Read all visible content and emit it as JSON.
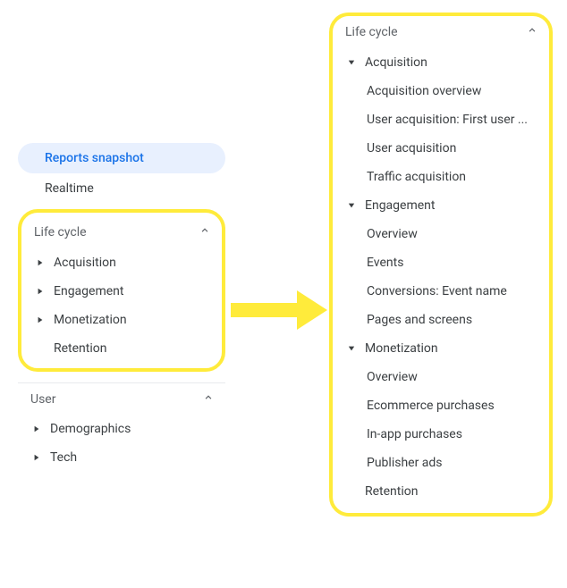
{
  "leftPanel": {
    "topItems": {
      "reportsSnapshot": "Reports snapshot",
      "realtime": "Realtime"
    },
    "lifeCycle": {
      "title": "Life cycle",
      "items": {
        "acquisition": "Acquisition",
        "engagement": "Engagement",
        "monetization": "Monetization",
        "retention": "Retention"
      }
    },
    "user": {
      "title": "User",
      "items": {
        "demographics": "Demographics",
        "tech": "Tech"
      }
    }
  },
  "rightPanel": {
    "lifeCycle": {
      "title": "Life cycle",
      "acquisition": {
        "label": "Acquisition",
        "children": {
          "overview": "Acquisition overview",
          "userFirst": "User acquisition: First user ...",
          "userAcq": "User acquisition",
          "trafficAcq": "Traffic acquisition"
        }
      },
      "engagement": {
        "label": "Engagement",
        "children": {
          "overview": "Overview",
          "events": "Events",
          "conversions": "Conversions: Event name",
          "pages": "Pages and screens"
        }
      },
      "monetization": {
        "label": "Monetization",
        "children": {
          "overview": "Overview",
          "ecommerce": "Ecommerce purchases",
          "inapp": "In-app purchases",
          "publisher": "Publisher ads"
        }
      },
      "retention": "Retention"
    }
  }
}
